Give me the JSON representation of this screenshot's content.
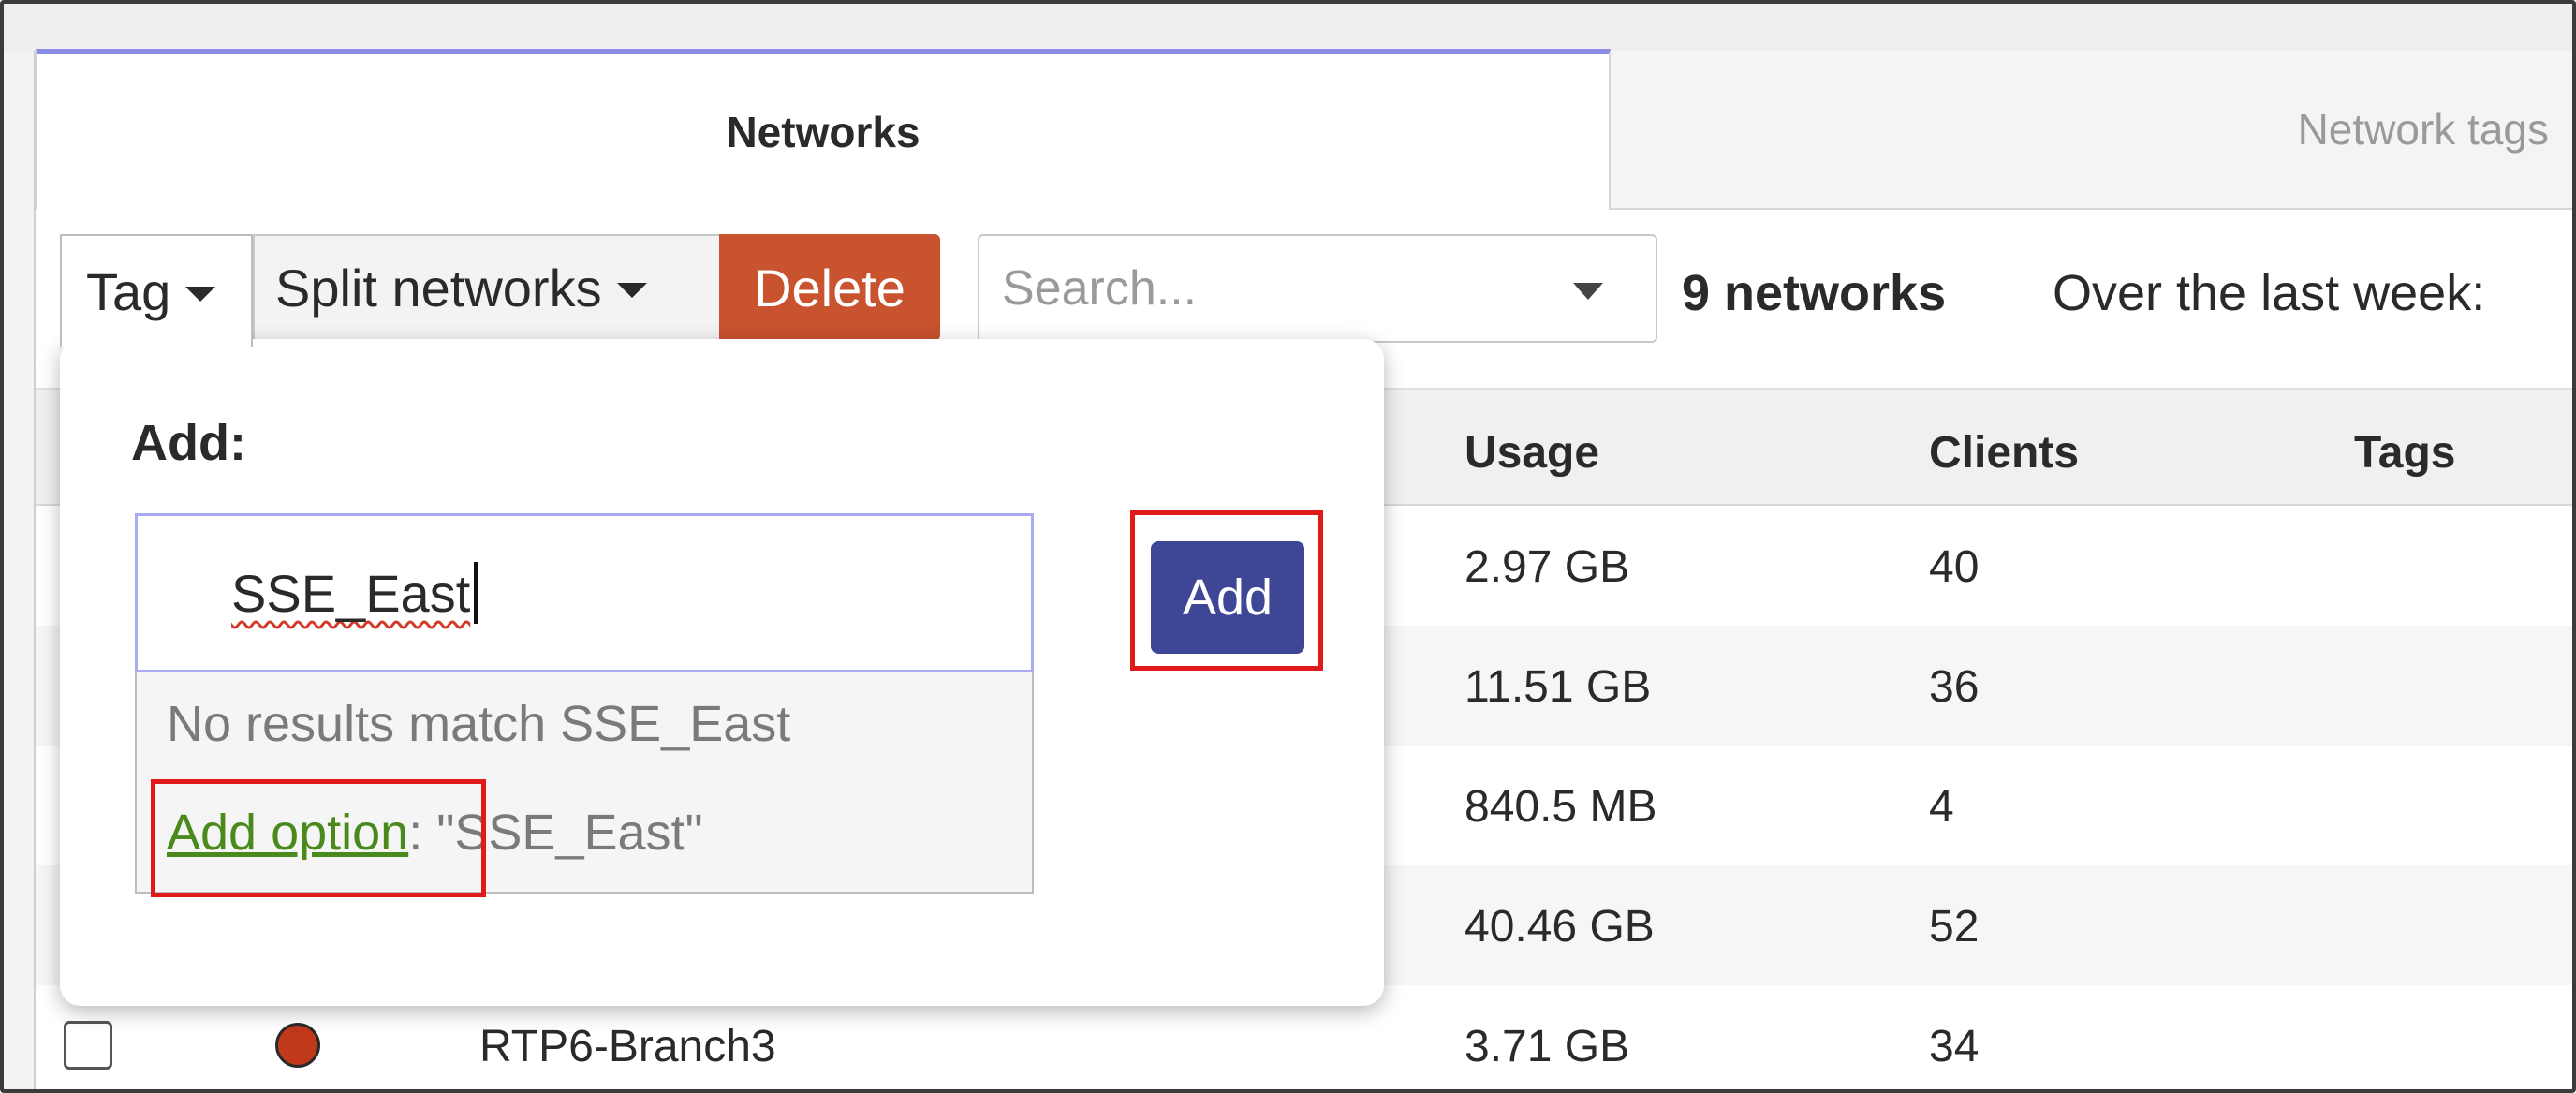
{
  "tabs": [
    {
      "label": "Networks",
      "active": true
    },
    {
      "label": "Network tags",
      "active": false
    }
  ],
  "toolbar": {
    "tag_label": "Tag",
    "split_label": "Split networks",
    "delete_label": "Delete",
    "search_placeholder": "Search...",
    "count_label": "9 networks",
    "period_label": "Over the last week:"
  },
  "table": {
    "headers": {
      "usage": "Usage",
      "clients": "Clients",
      "tags": "Tags"
    },
    "rows": [
      {
        "name": "",
        "usage": "2.97 GB",
        "clients": "40"
      },
      {
        "name": "",
        "usage": "11.51 GB",
        "clients": "36"
      },
      {
        "name": "",
        "usage": "840.5 MB",
        "clients": "4"
      },
      {
        "name": "",
        "usage": "40.46 GB",
        "clients": "52"
      },
      {
        "name": "RTP6-Branch3",
        "usage": "3.71 GB",
        "clients": "34"
      }
    ]
  },
  "popup": {
    "title": "Add:",
    "input_value": "SSE_East",
    "no_results": "No results match SSE_East",
    "add_option_link": "Add option",
    "add_option_rest": ": \"SSE_East\"",
    "add_button": "Add"
  },
  "colors": {
    "accent_tab": "#8a8ce6",
    "delete_button": "#c8532e",
    "add_button": "#3d4795",
    "highlight": "#e01a1a",
    "status_dot": "#c0391b",
    "link_green": "#4a8a1c"
  }
}
